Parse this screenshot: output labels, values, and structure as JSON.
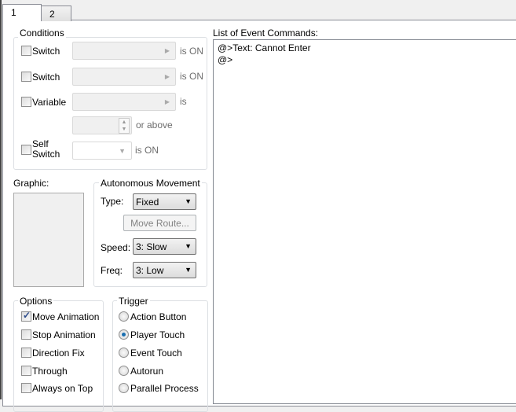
{
  "tabs": [
    {
      "label": "1"
    },
    {
      "label": "2"
    }
  ],
  "conditions": {
    "title": "Conditions",
    "switch1": {
      "label": "Switch",
      "suffix": "is ON"
    },
    "switch2": {
      "label": "Switch",
      "suffix": "is ON"
    },
    "variable": {
      "label": "Variable",
      "suffix": "is",
      "value_suffix": "or above"
    },
    "self_switch": {
      "label_line1": "Self",
      "label_line2": "Switch",
      "suffix": "is ON"
    }
  },
  "graphic": {
    "label": "Graphic:"
  },
  "movement": {
    "title": "Autonomous Movement",
    "type_label": "Type:",
    "type_value": "Fixed",
    "move_route": "Move Route...",
    "speed_label": "Speed:",
    "speed_value": "3: Slow",
    "freq_label": "Freq:",
    "freq_value": "3: Low"
  },
  "options": {
    "title": "Options",
    "items": [
      {
        "label": "Move Animation",
        "checked": true
      },
      {
        "label": "Stop Animation",
        "checked": false
      },
      {
        "label": "Direction Fix",
        "checked": false
      },
      {
        "label": "Through",
        "checked": false
      },
      {
        "label": "Always on Top",
        "checked": false
      }
    ]
  },
  "trigger": {
    "title": "Trigger",
    "items": [
      {
        "label": "Action Button"
      },
      {
        "label": "Player Touch",
        "selected": true
      },
      {
        "label": "Event Touch"
      },
      {
        "label": "Autorun"
      },
      {
        "label": "Parallel Process"
      }
    ]
  },
  "commands": {
    "title": "List of Event Commands:",
    "lines": [
      "@>Text: Cannot Enter",
      "@>"
    ]
  }
}
